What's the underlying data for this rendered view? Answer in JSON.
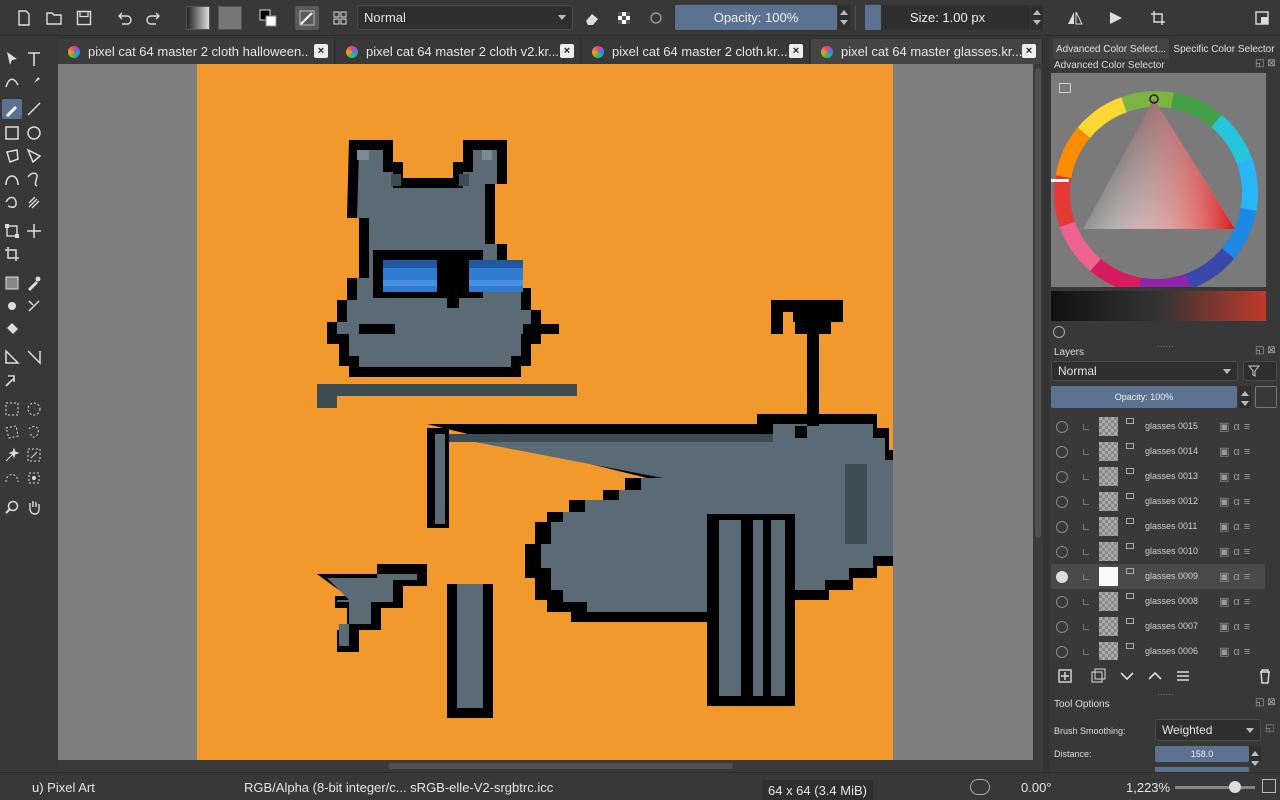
{
  "toolbar": {
    "blend_mode": "Normal",
    "opacity_label": "Opacity: 100%",
    "opacity_value": 1.0,
    "size_label": "Size: 1.00 px"
  },
  "tabs": [
    {
      "label": "pixel cat 64 master 2 cloth halloween...."
    },
    {
      "label": "pixel cat 64 master 2 cloth v2.kr..."
    },
    {
      "label": "pixel cat 64 master 2 cloth.kr..."
    },
    {
      "label": "pixel cat 64 master glasses.kr..."
    }
  ],
  "docker_tabs": {
    "advanced": "Advanced Color Select...",
    "specific": "Specific Color Selector"
  },
  "color_selector": {
    "title": "Advanced Color Selector",
    "selected_color": "#c0392b"
  },
  "layers": {
    "title": "Layers",
    "blend_mode": "Normal",
    "opacity_label": "Opacity:  100%",
    "items": [
      {
        "name": "glasses 0015",
        "visible": false
      },
      {
        "name": "glasses 0014",
        "visible": false
      },
      {
        "name": "glasses 0013",
        "visible": false
      },
      {
        "name": "glasses 0012",
        "visible": false
      },
      {
        "name": "glasses 0011",
        "visible": false
      },
      {
        "name": "glasses 0010",
        "visible": false
      },
      {
        "name": "glasses 0009",
        "visible": true,
        "selected": true
      },
      {
        "name": "glasses 0008",
        "visible": false
      },
      {
        "name": "glasses 0007",
        "visible": false
      },
      {
        "name": "glasses 0006",
        "visible": false
      }
    ]
  },
  "tool_options": {
    "title": "Tool Options",
    "brush_smoothing_label": "Brush Smoothing:",
    "brush_smoothing_value": "Weighted",
    "distance_label": "Distance:",
    "distance_value": "158.0"
  },
  "canvas": {
    "background_color": "#f2992e",
    "cat_body_color": "#5a6b75",
    "outline_color": "#000000",
    "glasses_color": "#2e7bd1"
  },
  "status": {
    "preset": "u) Pixel Art",
    "color_space": "RGB/Alpha (8-bit integer/c...  sRGB-elle-V2-srgbtrc.icc",
    "image_size": "64 x 64 (3.4 MiB)",
    "rotation": "0.00°",
    "zoom": "1,223%"
  },
  "colors": {
    "accent": "#5b7391",
    "panel": "#383838",
    "canvas_bg": "#7f7f7f"
  }
}
